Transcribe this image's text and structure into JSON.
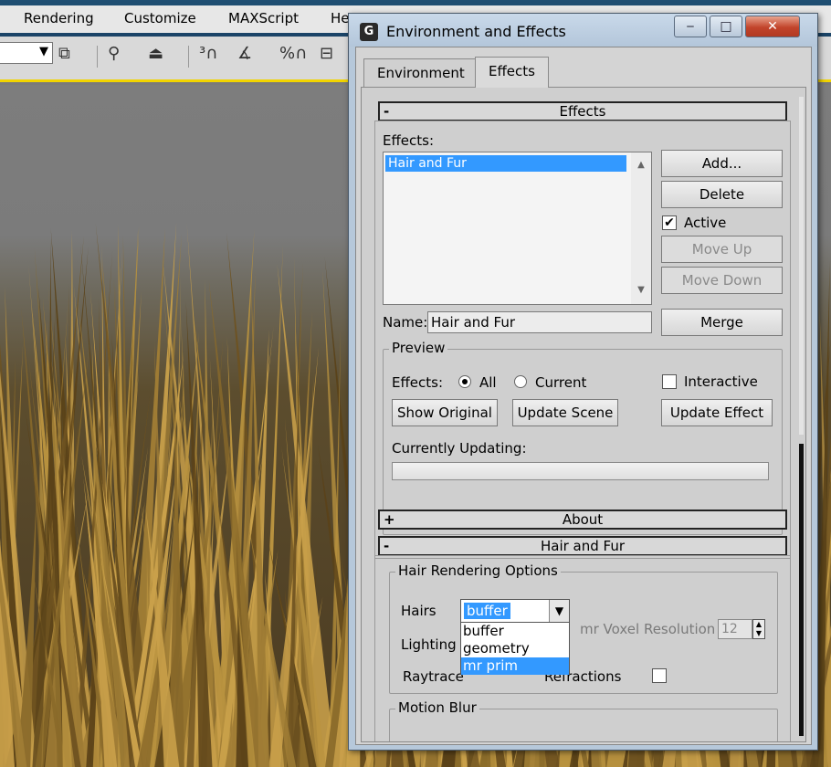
{
  "app": {
    "menu": [
      "Rendering",
      "Customize",
      "MAXScript",
      "He"
    ]
  },
  "dialog": {
    "title": "Environment and Effects",
    "logo": "G",
    "window_buttons": {
      "minimize": "‒",
      "maximize": "□",
      "close": "✕"
    },
    "tabs": [
      "Environment",
      "Effects"
    ],
    "active_tab": "Effects"
  },
  "effects_rollout": {
    "header": "Effects",
    "sign": "-",
    "effects_label": "Effects:",
    "list": [
      "Hair and Fur"
    ],
    "selected": "Hair and Fur",
    "buttons": {
      "add": "Add...",
      "delete": "Delete",
      "active": "Active",
      "move_up": "Move Up",
      "move_down": "Move Down",
      "merge": "Merge"
    },
    "active_checked": true,
    "name_label": "Name:",
    "name_value": "Hair and Fur"
  },
  "preview": {
    "label": "Preview",
    "effects_label": "Effects:",
    "radio_all": "All",
    "radio_current": "Current",
    "selected_radio": "All",
    "interactive": "Interactive",
    "interactive_checked": false,
    "show_original": "Show Original",
    "update_scene": "Update Scene",
    "update_effect": "Update Effect",
    "currently_updating": "Currently Updating:"
  },
  "about_rollout": {
    "header": "About",
    "sign": "+"
  },
  "hair_rollout": {
    "header": "Hair and Fur",
    "sign": "-",
    "options_label": "Hair Rendering Options",
    "hairs_label": "Hairs",
    "hairs_value": "buffer",
    "hairs_options": [
      "buffer",
      "geometry",
      "mr prim"
    ],
    "hairs_highlighted": "mr prim",
    "lighting_label": "Lighting",
    "voxel_label": "mr Voxel Resolution",
    "voxel_value": "12",
    "raytrace_label": "Raytrace the Reflections/Refractions",
    "raytrace_visible": "Raytrace",
    "raytrace_tail": "Refractions",
    "motion_blur_label": "Motion Blur"
  }
}
